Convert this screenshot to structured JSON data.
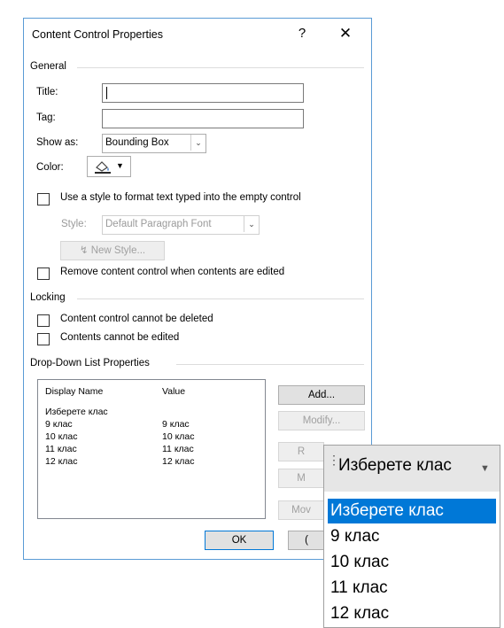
{
  "dialog": {
    "title": "Content Control Properties",
    "help": "?",
    "close": "✕"
  },
  "general": {
    "heading": "General",
    "title_label": "Title:",
    "tag_label": "Tag:",
    "show_as_label": "Show as:",
    "show_as_value": "Bounding Box",
    "color_label": "Color:",
    "use_style_label": "Use a style to format text typed into the empty control",
    "style_label": "Style:",
    "style_value": "Default Paragraph Font",
    "new_style_button": "New Style...",
    "remove_label": "Remove content control when contents are edited"
  },
  "locking": {
    "heading": "Locking",
    "cannot_delete": "Content control cannot be deleted",
    "cannot_edit": "Contents cannot be edited"
  },
  "dropdown": {
    "heading": "Drop-Down List Properties",
    "col_display": "Display Name",
    "col_value": "Value",
    "rows": [
      {
        "display": "Изберете клас",
        "value": ""
      },
      {
        "display": "9 клас",
        "value": "9 клас"
      },
      {
        "display": "10 клас",
        "value": "10 клас"
      },
      {
        "display": "11 клас",
        "value": "11 клас"
      },
      {
        "display": "12 клас",
        "value": "12 клас"
      }
    ],
    "add": "Add...",
    "modify": "Modify...",
    "remove_partial": "R",
    "move_up_partial": "M",
    "move_down_partial": "Mov"
  },
  "footer": {
    "ok": "OK",
    "cancel_partial": "("
  },
  "popup": {
    "current": "Изберете клас",
    "items": [
      "Изберете клас",
      "9 клас",
      "10 клас",
      "11 клас",
      "12 клас"
    ],
    "selected_index": 0
  }
}
